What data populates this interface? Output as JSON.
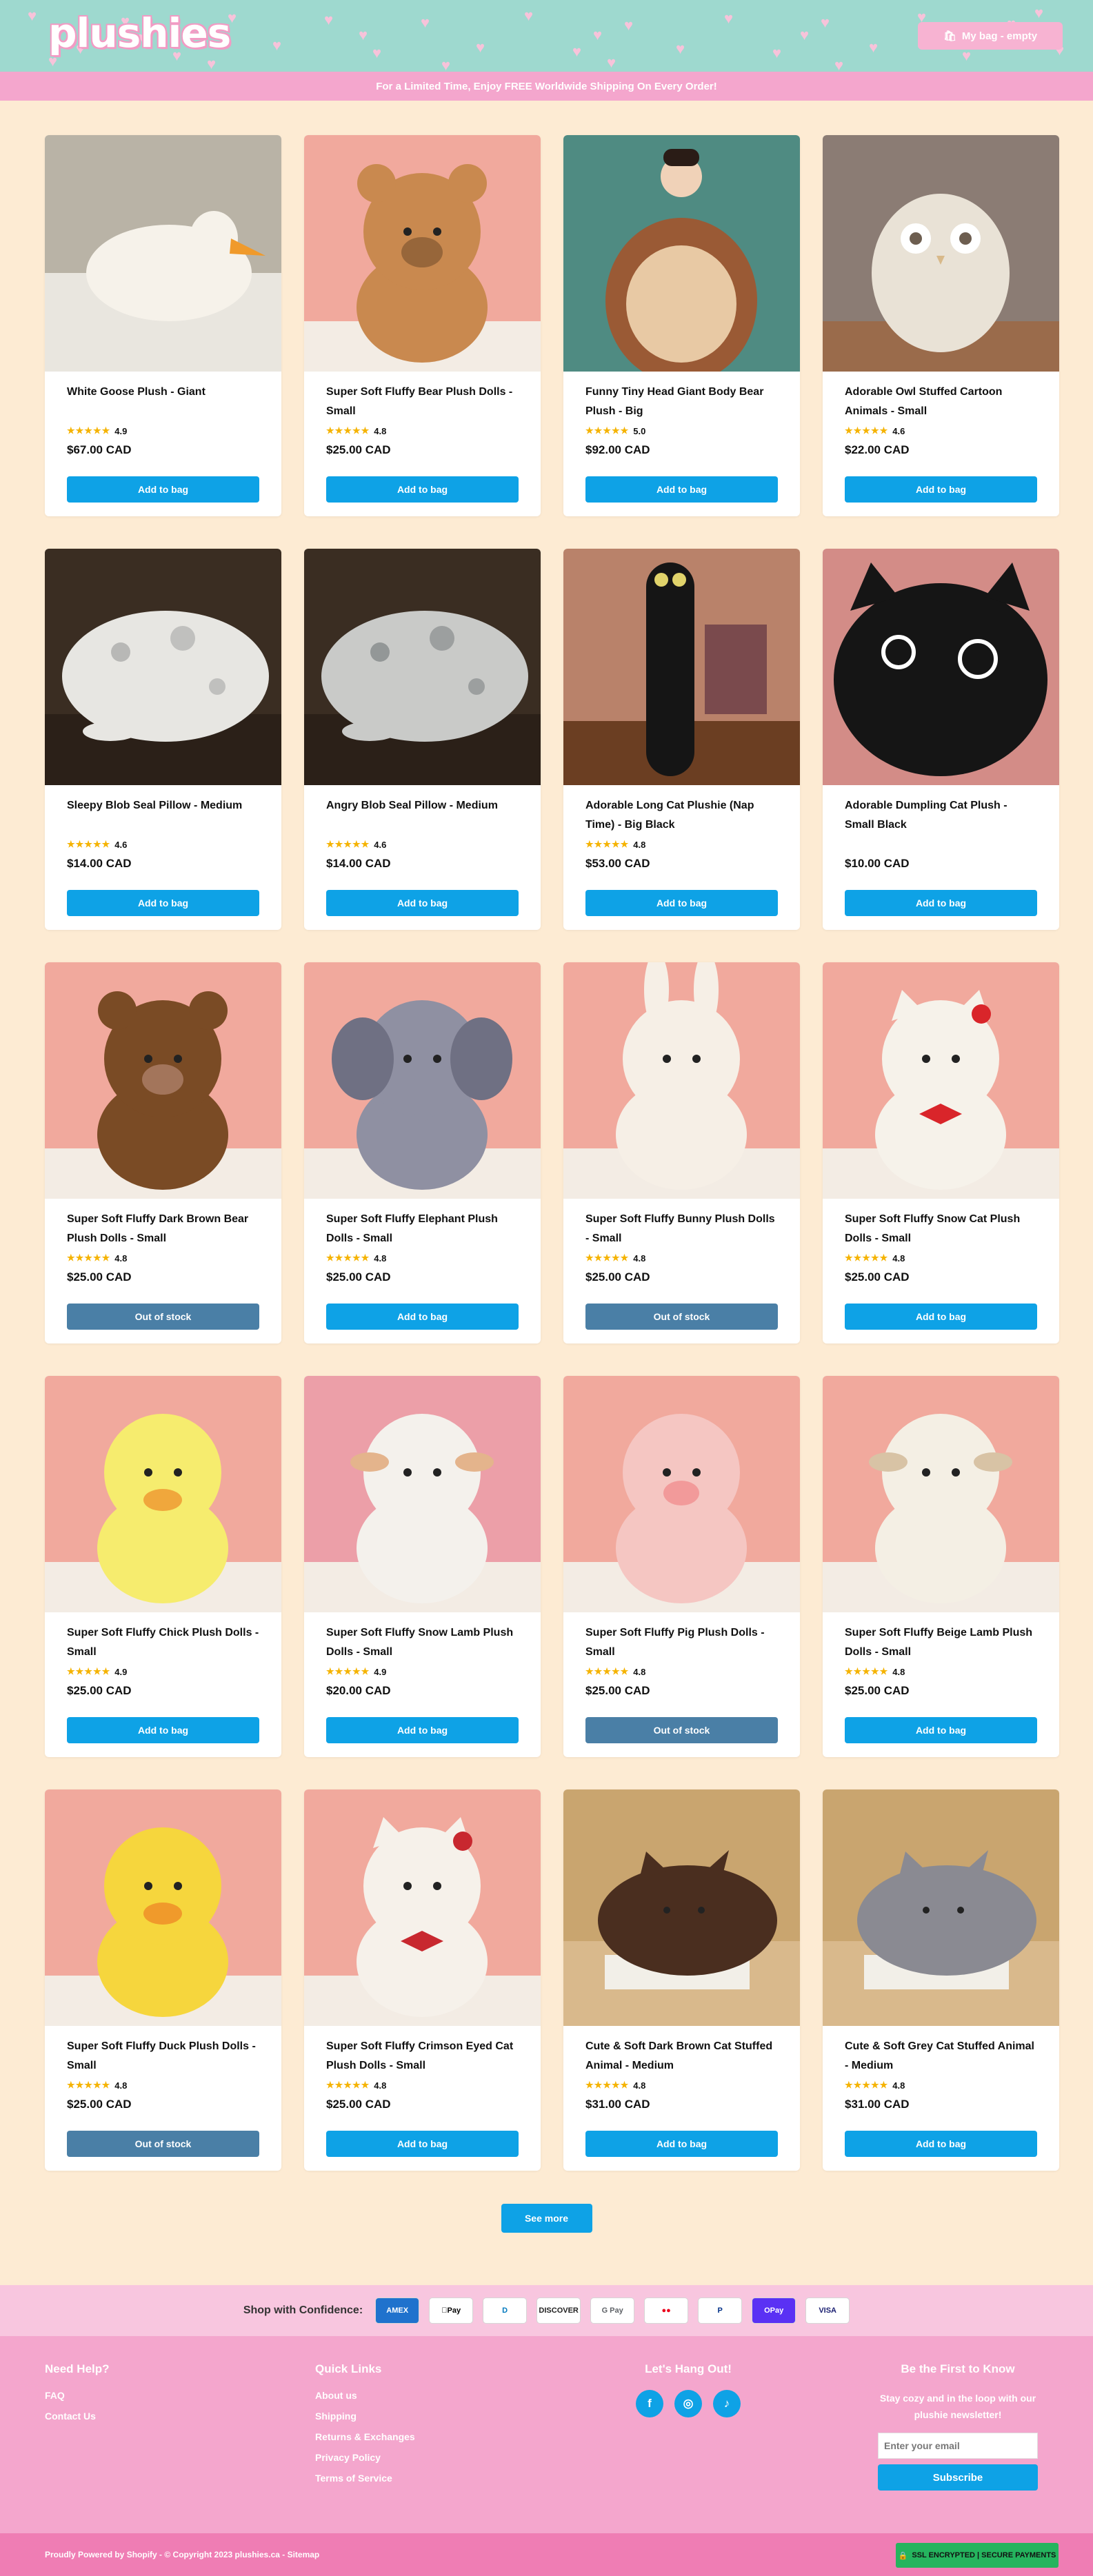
{
  "brand": {
    "logo": "plushies"
  },
  "header": {
    "bag_label": "My bag - empty"
  },
  "promo": "For a Limited Time, Enjoy FREE Worldwide Shipping On Every Order!",
  "products": [
    {
      "name": "White Goose Plush - Giant",
      "rating": "4.9",
      "price": "$67.00 CAD",
      "button": "Add to bag",
      "in_stock": true,
      "img": {
        "bg": "#b9b3a6",
        "body": "#f6f2ea",
        "accent": "#f09a2b",
        "kind": "goose"
      }
    },
    {
      "name": "Super Soft Fluffy Bear Plush Dolls - Small",
      "rating": "4.8",
      "price": "$25.00 CAD",
      "button": "Add to bag",
      "in_stock": true,
      "img": {
        "bg": "#f1a99d",
        "body": "#c9894f",
        "accent": "#3a2414",
        "kind": "bear"
      }
    },
    {
      "name": "Funny Tiny Head Giant Body Bear Plush - Big",
      "rating": "5.0",
      "price": "$92.00 CAD",
      "button": "Add to bag",
      "in_stock": true,
      "img": {
        "bg": "#4f8b82",
        "body": "#9a5a35",
        "accent": "#e8c9a4",
        "kind": "bigbear"
      }
    },
    {
      "name": "Adorable Owl Stuffed Cartoon Animals - Small",
      "rating": "4.6",
      "price": "$22.00 CAD",
      "button": "Add to bag",
      "in_stock": true,
      "img": {
        "bg": "#8b7c74",
        "body": "#e9e2d6",
        "accent": "#6d5e50",
        "kind": "owl"
      }
    },
    {
      "name": "Sleepy Blob Seal Pillow - Medium",
      "rating": "4.6",
      "price": "$14.00 CAD",
      "button": "Add to bag",
      "in_stock": true,
      "img": {
        "bg": "#3a2d22",
        "body": "#e7e6e2",
        "accent": "#9a9a9a",
        "kind": "seal"
      }
    },
    {
      "name": "Angry Blob Seal Pillow - Medium",
      "rating": "4.6",
      "price": "$14.00 CAD",
      "button": "Add to bag",
      "in_stock": true,
      "img": {
        "bg": "#3a2d22",
        "body": "#c9cac8",
        "accent": "#6f7476",
        "kind": "seal"
      }
    },
    {
      "name": "Adorable Long Cat Plushie (Nap Time) - Big Black",
      "rating": "4.8",
      "price": "$53.00 CAD",
      "button": "Add to bag",
      "in_stock": true,
      "img": {
        "bg": "#b9826a",
        "body": "#151515",
        "accent": "#e0d36b",
        "kind": "longcat"
      }
    },
    {
      "name": "Adorable Dumpling Cat Plush - Small Black",
      "rating": "",
      "price": "$10.00 CAD",
      "button": "Add to bag",
      "in_stock": true,
      "img": {
        "bg": "#d38c87",
        "body": "#151515",
        "accent": "#ffffff",
        "kind": "dumpling"
      }
    },
    {
      "name": "Super Soft Fluffy Dark Brown Bear Plush Dolls - Small",
      "rating": "4.8",
      "price": "$25.00 CAD",
      "button": "Out of stock",
      "in_stock": false,
      "img": {
        "bg": "#f1a99d",
        "body": "#7a4b25",
        "accent": "#f0c7c0",
        "kind": "bear"
      }
    },
    {
      "name": "Super Soft Fluffy Elephant Plush Dolls - Small",
      "rating": "4.8",
      "price": "$25.00 CAD",
      "button": "Add to bag",
      "in_stock": true,
      "img": {
        "bg": "#f1a99d",
        "body": "#8f90a2",
        "accent": "#6f7083",
        "kind": "elephant"
      }
    },
    {
      "name": "Super Soft Fluffy Bunny Plush Dolls - Small",
      "rating": "4.8",
      "price": "$25.00 CAD",
      "button": "Out of stock",
      "in_stock": false,
      "img": {
        "bg": "#f1a99d",
        "body": "#f6efe6",
        "accent": "#f3b9b6",
        "kind": "bunny"
      }
    },
    {
      "name": "Super Soft Fluffy Snow Cat Plush Dolls - Small",
      "rating": "4.8",
      "price": "$25.00 CAD",
      "button": "Add to bag",
      "in_stock": true,
      "img": {
        "bg": "#f1a99d",
        "body": "#f6f2ea",
        "accent": "#d9252a",
        "kind": "cat"
      }
    },
    {
      "name": "Super Soft Fluffy Chick Plush Dolls - Small",
      "rating": "4.9",
      "price": "$25.00 CAD",
      "button": "Add to bag",
      "in_stock": true,
      "img": {
        "bg": "#f1a99d",
        "body": "#f6ec6e",
        "accent": "#f0a73c",
        "kind": "chick"
      }
    },
    {
      "name": "Super Soft Fluffy Snow Lamb Plush Dolls - Small",
      "rating": "4.9",
      "price": "$20.00 CAD",
      "button": "Add to bag",
      "in_stock": true,
      "img": {
        "bg": "#ec9fa8",
        "body": "#f4f1ec",
        "accent": "#e4b48c",
        "kind": "lamb"
      }
    },
    {
      "name": "Super Soft Fluffy Pig Plush Dolls - Small",
      "rating": "4.8",
      "price": "$25.00 CAD",
      "button": "Out of stock",
      "in_stock": false,
      "img": {
        "bg": "#f1a99d",
        "body": "#f5c6c2",
        "accent": "#f29a9a",
        "kind": "pig"
      }
    },
    {
      "name": "Super Soft Fluffy Beige Lamb Plush Dolls - Small",
      "rating": "4.8",
      "price": "$25.00 CAD",
      "button": "Add to bag",
      "in_stock": true,
      "img": {
        "bg": "#f1a99d",
        "body": "#f4efe4",
        "accent": "#d8c3a5",
        "kind": "lamb"
      }
    },
    {
      "name": "Super Soft Fluffy Duck Plush Dolls - Small",
      "rating": "4.8",
      "price": "$25.00 CAD",
      "button": "Out of stock",
      "in_stock": false,
      "img": {
        "bg": "#f1a99d",
        "body": "#f6d63d",
        "accent": "#f09a2b",
        "kind": "chick"
      }
    },
    {
      "name": "Super Soft Fluffy Crimson Eyed Cat Plush Dolls - Small",
      "rating": "4.8",
      "price": "$25.00 CAD",
      "button": "Add to bag",
      "in_stock": true,
      "img": {
        "bg": "#f1a99d",
        "body": "#f6f1ea",
        "accent": "#c8282f",
        "kind": "cat"
      }
    },
    {
      "name": "Cute & Soft Dark Brown Cat Stuffed Animal - Medium",
      "rating": "4.8",
      "price": "$31.00 CAD",
      "button": "Add to bag",
      "in_stock": true,
      "img": {
        "bg": "#c9a56f",
        "body": "#4a2e1f",
        "accent": "#d9b98c",
        "kind": "loaf"
      }
    },
    {
      "name": "Cute & Soft Grey Cat Stuffed Animal - Medium",
      "rating": "4.8",
      "price": "$31.00 CAD",
      "button": "Add to bag",
      "in_stock": true,
      "img": {
        "bg": "#c9a56f",
        "body": "#8a8a92",
        "accent": "#d5d2cc",
        "kind": "loaf"
      }
    }
  ],
  "see_more": "See more",
  "payments": {
    "label": "Shop with Confidence:",
    "methods": [
      {
        "name": "AMEX",
        "fg": "#ffffff",
        "bg": "#1f72cd"
      },
      {
        "name": "Pay",
        "fg": "#000000",
        "bg": "#ffffff"
      },
      {
        "name": "D",
        "fg": "#0079be",
        "bg": "#ffffff"
      },
      {
        "name": "DISCOVER",
        "fg": "#222222",
        "bg": "#ffffff"
      },
      {
        "name": "G Pay",
        "fg": "#5f6368",
        "bg": "#ffffff"
      },
      {
        "name": "●●",
        "fg": "#eb001b",
        "bg": "#ffffff"
      },
      {
        "name": "P",
        "fg": "#003087",
        "bg": "#ffffff"
      },
      {
        "name": "OPay",
        "fg": "#ffffff",
        "bg": "#5a31f4"
      },
      {
        "name": "VISA",
        "fg": "#1a1f71",
        "bg": "#ffffff"
      }
    ]
  },
  "footer": {
    "help": {
      "title": "Need Help?",
      "links": [
        "FAQ",
        "Contact Us"
      ]
    },
    "quick": {
      "title": "Quick Links",
      "links": [
        "About us",
        "Shipping",
        "Returns & Exchanges",
        "Privacy Policy",
        "Terms of Service"
      ]
    },
    "social": {
      "title": "Let's Hang Out!",
      "icons": [
        "f",
        "◎",
        "♪"
      ]
    },
    "newsletter": {
      "title": "Be the First to Know",
      "text": "Stay cozy and in the loop with our plushie newsletter!",
      "placeholder": "Enter your email",
      "button": "Subscribe"
    }
  },
  "bottom": {
    "copyright": "Proudly Powered by Shopify - © Copyright 2023 plushies.ca - Sitemap",
    "ssl": "SSL ENCRYPTED | SECURE PAYMENTS"
  }
}
